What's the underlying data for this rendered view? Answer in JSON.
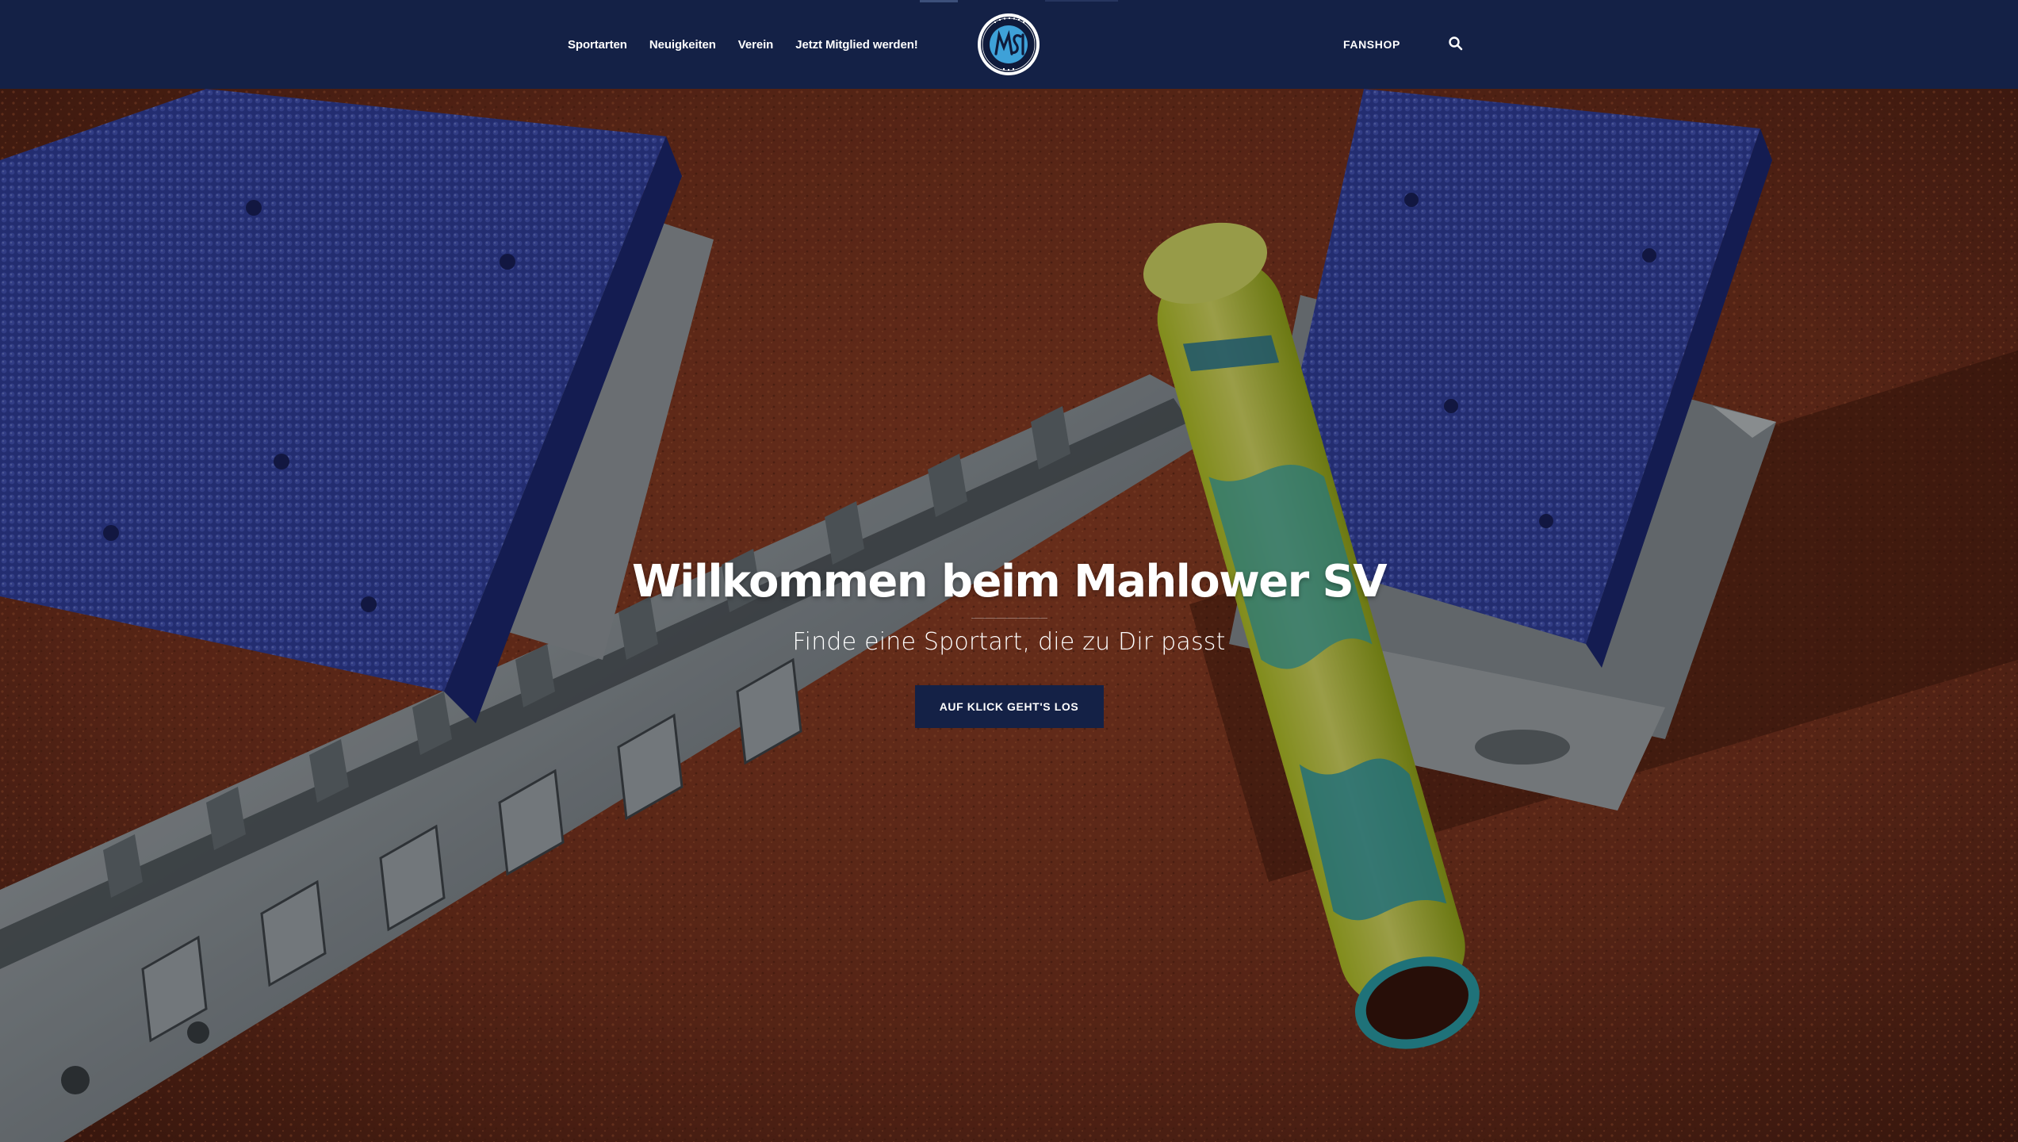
{
  "header": {
    "nav": [
      {
        "label": "Sportarten"
      },
      {
        "label": "Neuigkeiten"
      },
      {
        "label": "Verein"
      },
      {
        "label": "Jetzt Mitglied werden!"
      }
    ],
    "logo_icon": "club-crest-logo",
    "fanshop_label": "FANSHOP",
    "search_icon": "search-icon"
  },
  "hero": {
    "title": "Willkommen beim Mahlower SV",
    "subtitle": "Finde eine Sportart, die zu Dir passt",
    "cta_label": "AUF KLICK GEHT'S LOS",
    "background_description_icon": "starting-block-with-relay-baton-image"
  },
  "colors": {
    "brand_navy": "#142146",
    "track_red": "#8a3a22",
    "block_blue": "#2f3fa0",
    "baton_yellow": "#cfd83a"
  }
}
